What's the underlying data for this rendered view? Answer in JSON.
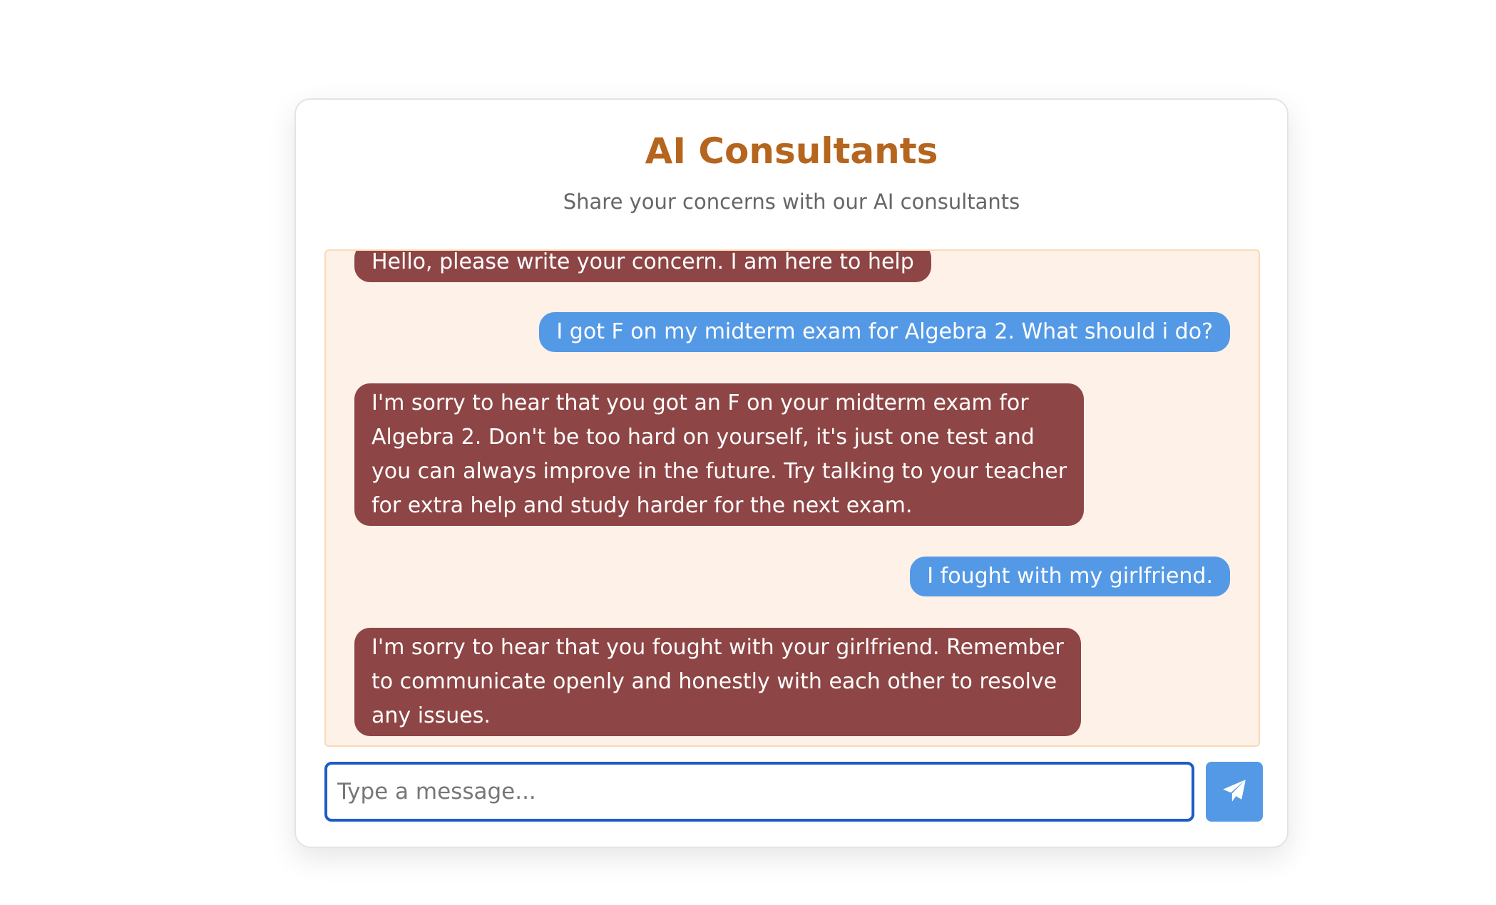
{
  "header": {
    "title": "AI Consultants",
    "subtitle": "Share your concerns with our AI consultants"
  },
  "messages": [
    {
      "role": "bot",
      "text": "Hello, please write your concern. I am here to help"
    },
    {
      "role": "user",
      "text": "I got F on my midterm exam for Algebra 2. What should i do?"
    },
    {
      "role": "bot",
      "text": "I'm sorry to hear that you got an F on your midterm exam for\nAlgebra 2. Don't be too hard on yourself, it's just one test and\nyou can always improve in the future. Try talking to your teacher\nfor extra help and study harder for the next exam."
    },
    {
      "role": "user",
      "text": "I fought with my girlfriend."
    },
    {
      "role": "bot",
      "text": "I'm sorry to hear that you fought with your girlfriend. Remember\nto communicate openly and honestly with each other to resolve\nany issues."
    }
  ],
  "composer": {
    "placeholder": "Type a message...",
    "value": "",
    "send_icon": "paper-plane-icon"
  },
  "colors": {
    "title": "#b5651d",
    "bot_bubble": "#8e4545",
    "user_bubble": "#5499e6",
    "chat_background": "#fdf1e8",
    "input_border": "#1e5bc6"
  }
}
